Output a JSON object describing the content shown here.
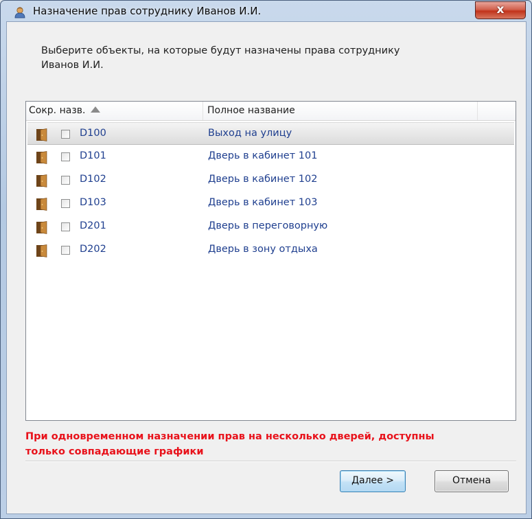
{
  "window": {
    "title": "Назначение прав сотруднику Иванов И.И.",
    "close_label": "x"
  },
  "instruction": {
    "line1": "Выберите объекты, на которые будут назначены права сотруднику",
    "line2": "Иванов И.И."
  },
  "grid": {
    "columns": {
      "short": "Сокр. назв.",
      "full": "Полное название",
      "sort": "ascending"
    },
    "rows": [
      {
        "short": "D100",
        "full": "Выход на улицу",
        "checked": false,
        "selected": true,
        "icon": "door-icon"
      },
      {
        "short": "D101",
        "full": "Дверь в кабинет 101",
        "checked": false,
        "selected": false,
        "icon": "door-icon"
      },
      {
        "short": "D102",
        "full": "Дверь в кабинет 102",
        "checked": false,
        "selected": false,
        "icon": "door-icon"
      },
      {
        "short": "D103",
        "full": "Дверь в кабинет 103",
        "checked": false,
        "selected": false,
        "icon": "door-icon"
      },
      {
        "short": "D201",
        "full": "Дверь в переговорную",
        "checked": false,
        "selected": false,
        "icon": "door-icon"
      },
      {
        "short": "D202",
        "full": "Дверь в зону отдыха",
        "checked": false,
        "selected": false,
        "icon": "door-icon"
      }
    ]
  },
  "warning": {
    "line1": "При одновременном назначении прав на несколько дверей, доступны",
    "line2": "только совпадающие графики",
    "color": "#e8121b"
  },
  "buttons": {
    "next_first": "Д",
    "next_rest": "алее >",
    "cancel": "Отмена"
  },
  "colors": {
    "link_text": "#1f3f8f",
    "primary_button_border": "#3c7fb1"
  }
}
